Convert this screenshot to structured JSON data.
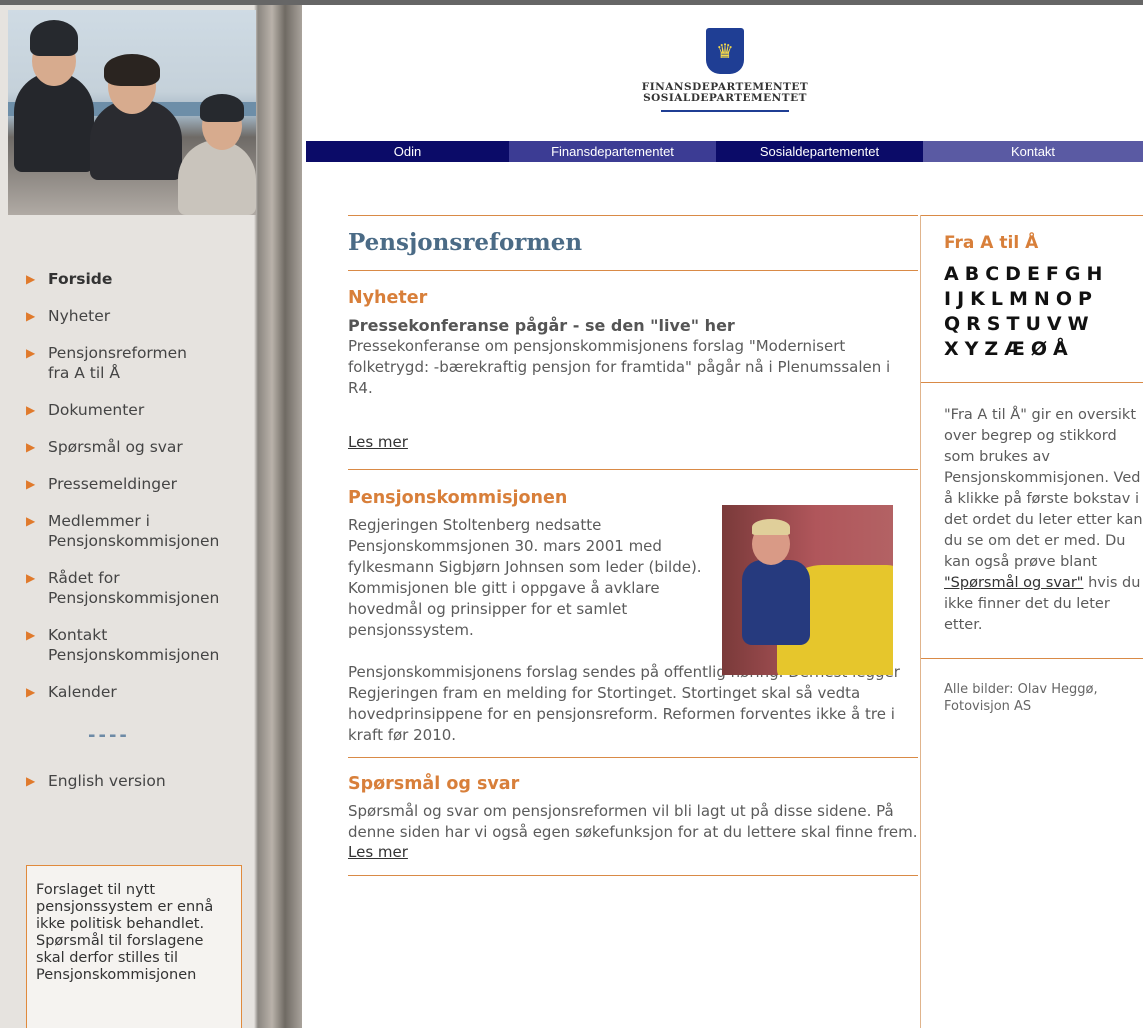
{
  "header": {
    "org_line1": "FINANSDEPARTEMENTET",
    "org_line2": "SOSIALDEPARTEMENTET",
    "tabs": [
      {
        "label": "Odin",
        "color": "#0b0b68"
      },
      {
        "label": "Finansdepartementet",
        "color": "#3c3c94"
      },
      {
        "label": "Sosialdepartementet",
        "color": "#0b0b68"
      },
      {
        "label": "Kontakt",
        "color": "#5a5aa3"
      }
    ]
  },
  "sidebar": {
    "items": [
      {
        "label": "Forside"
      },
      {
        "label": "Nyheter"
      },
      {
        "label": "Pensjonsreformen\nfra A til Å"
      },
      {
        "label": "Dokumenter"
      },
      {
        "label": "Spørsmål og svar"
      },
      {
        "label": "Pressemeldinger"
      },
      {
        "label": "Medlemmer i\nPensjonskommisjonen"
      },
      {
        "label": "Rådet for\nPensjonskommisjonen"
      },
      {
        "label": "Kontakt\nPensjonskommisjonen"
      },
      {
        "label": "Kalender"
      }
    ],
    "separator": "----",
    "english": "English version",
    "notice": "Forslaget til nytt pensjonssystem er ennå ikke politisk behandlet. Spørsmål til forslagene skal derfor stilles til Pensjonskommisjonen"
  },
  "main": {
    "title": "Pensjonsreformen",
    "news": {
      "heading": "Nyheter",
      "headline": "Pressekonferanse pågår - se den \"live\" her",
      "text": "Pressekonferanse om pensjonskommisjonens forslag \"Modernisert folketrygd: -bærekraftig pensjon for framtida\" pågår nå i Plenumssalen i R4.",
      "more": "Les mer"
    },
    "commission": {
      "heading": "Pensjonskommisjonen",
      "text1": "Regjeringen Stoltenberg nedsatte Pensjonskommsjonen 30. mars 2001 med fylkesmann Sigbjørn Johnsen som leder (bilde). Kommisjonen ble gitt i oppgave å avklare hovedmål og prinsipper for et samlet pensjonssystem.",
      "text2": "Pensjonskommisjonens forslag sendes på offentlig høring. Dernest legger Regjeringen fram en melding for Stortinget. Stortinget skal så vedta hovedprinsippene for en pensjonsreform. Reformen forventes ikke å tre i kraft før 2010."
    },
    "qa": {
      "heading": "Spørsmål og svar",
      "text": "Spørsmål og svar om pensjonsreformen vil bli lagt ut på disse sidene. På denne siden har vi også egen søkefunksjon for at du lettere skal finne frem.",
      "more": "Les mer"
    }
  },
  "right": {
    "title": "Fra A til Å",
    "letters": [
      "A",
      "B",
      "C",
      "D",
      "E",
      "F",
      "G",
      "H",
      "I",
      "J",
      "K",
      "L",
      "M",
      "N",
      "O",
      "P",
      "Q",
      "R",
      "S",
      "T",
      "U",
      "V",
      "W",
      "X",
      "Y",
      "Z",
      "Æ",
      "Ø",
      "Å"
    ],
    "desc_before": "\"Fra A til Å\" gir en oversikt over begrep og stikkord som brukes av Pensjonskommisjonen. Ved å klikke på første bokstav i det ordet du leter etter kan du se om det er med. Du kan også prøve blant",
    "desc_link": "\"Spørsmål og svar\"",
    "desc_after": "hvis du ikke finner det du leter etter.",
    "credit": "Alle bilder: Olav Heggø, Fotovisjon AS"
  },
  "colors": {
    "accent": "#d87f3a",
    "title_blue": "#4b6b86"
  }
}
